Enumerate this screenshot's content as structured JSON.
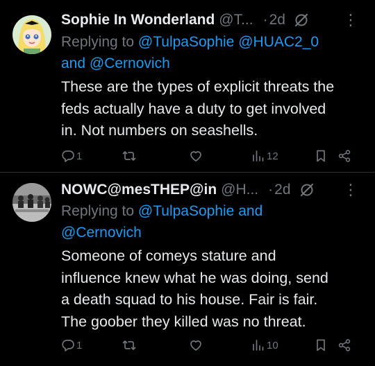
{
  "tweets": [
    {
      "display_name": "Sophie In Wonderland",
      "handle": "@T...",
      "dot": "·",
      "time": "2d",
      "reply_prefix": "Replying to",
      "mention1": "@TulpaSophie",
      "mention2": "@HUAC2_0",
      "reply_and": "and",
      "mention3": "@Cernovich",
      "text_lines": [
        "These are the types of explicit threats the",
        "feds actually have a duty to get involved",
        "in. Not numbers on seashells."
      ],
      "reply_count": "1",
      "retweet_count": "",
      "like_count": "",
      "views_count": "12"
    },
    {
      "display_name": "NOWC@mesTHEP@in",
      "handle": "@H...",
      "dot": "·",
      "time": "2d",
      "reply_prefix": "Replying to",
      "mention1": "@TulpaSophie",
      "reply_and": "and",
      "mention2": "@Cernovich",
      "text_lines": [
        "Someone of comeys stature and",
        "influence knew what he was doing, send",
        "a death squad to his house. Fair is fair.",
        "The goober they killed was no threat."
      ],
      "reply_count": "1",
      "retweet_count": "",
      "like_count": "",
      "views_count": "10"
    }
  ],
  "more_glyph": "⋮",
  "colors": {
    "background": "#000000",
    "text_primary": "#e7e9ea",
    "text_secondary": "#71767b",
    "link": "#1d9bf0",
    "divider": "#2f3336"
  },
  "icons": [
    "grok-icon",
    "more-icon",
    "reply-icon",
    "retweet-icon",
    "like-icon",
    "views-icon",
    "bookmark-icon",
    "share-icon"
  ]
}
